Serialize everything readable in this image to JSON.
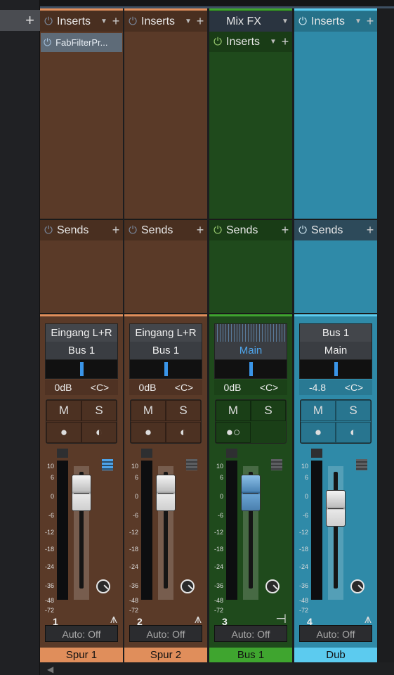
{
  "left": {
    "add_label": "+"
  },
  "common": {
    "inserts": "Inserts",
    "sends": "Sends",
    "mute": "M",
    "solo": "S",
    "plus": "+",
    "tri": "▼",
    "power": "⏻",
    "auto": "Auto: Off"
  },
  "scale": [
    "10",
    "6",
    "0",
    "-6",
    "-12",
    "-18",
    "-24",
    "-36",
    "-48",
    "-72"
  ],
  "channels": [
    {
      "name": "Spur 1",
      "number": "1",
      "color": "#e08e5b",
      "body": "#5a3a28",
      "plugin": "FabFilterPr...",
      "input": "Eingang L+R",
      "output": "Bus 1",
      "volume": "0dB",
      "pan": "<C>",
      "fader_db": 0,
      "track_icon": "waveform-icon"
    },
    {
      "name": "Spur 2",
      "number": "2",
      "color": "#e08e5b",
      "body": "#5a3a28",
      "input": "Eingang L+R",
      "output": "Bus 1",
      "volume": "0dB",
      "pan": "<C>",
      "fader_db": 0,
      "track_icon": "waveform-icon"
    },
    {
      "name": "Bus 1",
      "number": "3",
      "color": "#3fa52f",
      "body": "#1f4a1c",
      "top_label": "Mix FX",
      "output": "Main",
      "volume": "0dB",
      "pan": "<C>",
      "fader_db": 0,
      "track_icon": "bus-icon"
    },
    {
      "name": "Dub",
      "number": "4",
      "color": "#5ccbef",
      "body": "#2f8aa8",
      "input": "Bus 1",
      "output": "Main",
      "volume": "-4.8",
      "pan": "<C>",
      "fader_db": -4.8,
      "track_icon": "waveform-icon"
    }
  ]
}
